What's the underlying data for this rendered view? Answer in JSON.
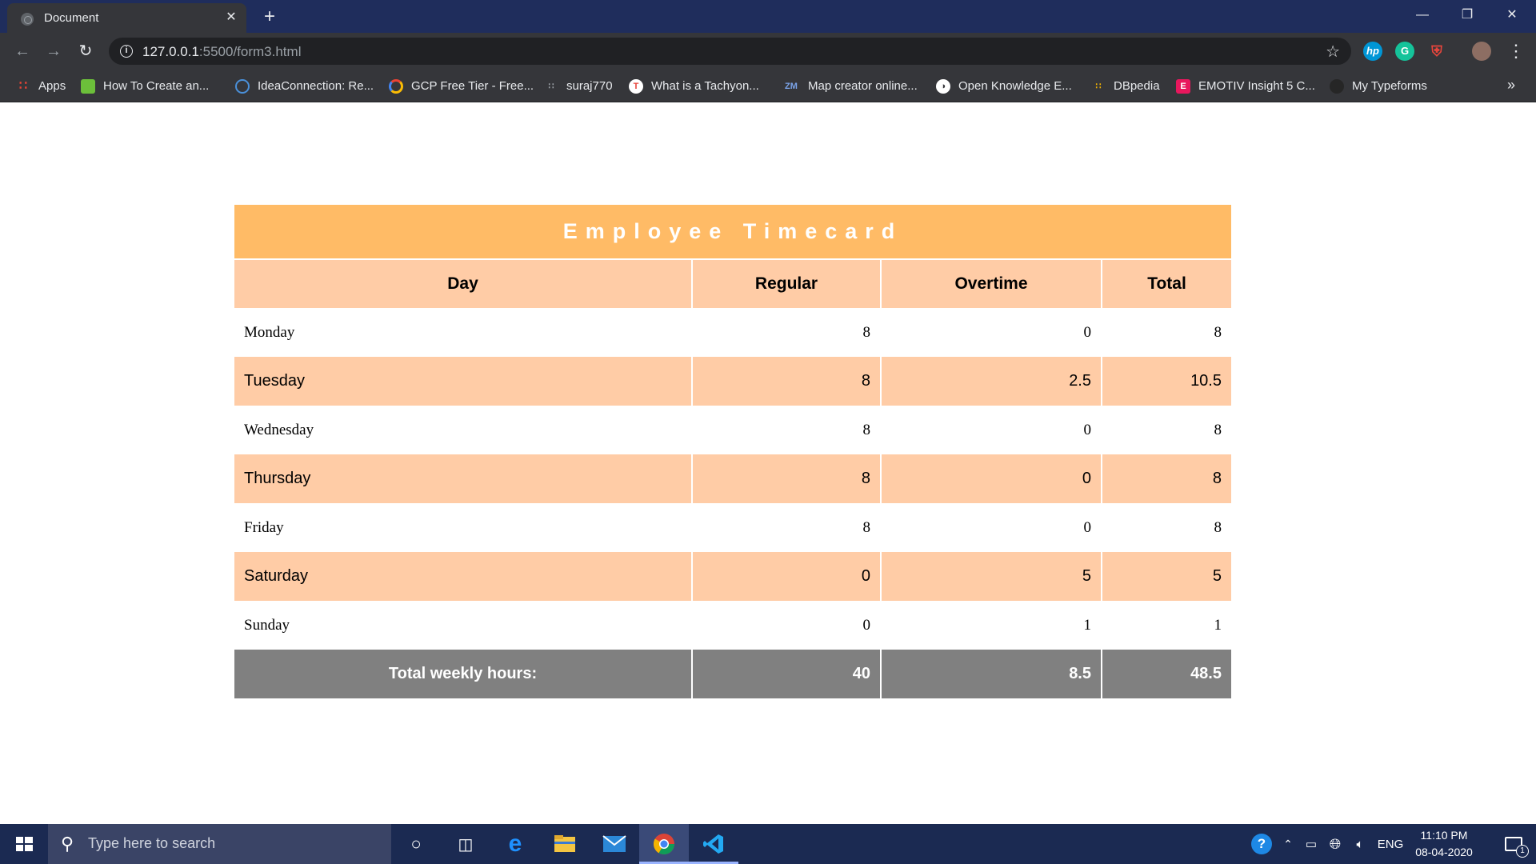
{
  "browser": {
    "tab_title": "Document",
    "url_host": "127.0.0.1",
    "url_path": ":5500/form3.html",
    "bookmarks": [
      {
        "label": "Apps",
        "icon": "apps-grid-icon"
      },
      {
        "label": "How To Create an...",
        "icon": "bookmark-favicon"
      },
      {
        "label": "IdeaConnection: Re...",
        "icon": "bookmark-favicon"
      },
      {
        "label": "GCP Free Tier - Free...",
        "icon": "google-cloud-icon"
      },
      {
        "label": "suraj770",
        "icon": "bookmark-favicon"
      },
      {
        "label": "What is a Tachyon...",
        "icon": "bookmark-favicon"
      },
      {
        "label": "Map creator online...",
        "icon": "bookmark-favicon"
      },
      {
        "label": "Open Knowledge E...",
        "icon": "globe-icon"
      },
      {
        "label": "DBpedia",
        "icon": "bookmark-favicon"
      },
      {
        "label": "EMOTIV Insight 5 C...",
        "icon": "bookmark-favicon"
      },
      {
        "label": "My Typeforms",
        "icon": "bookmark-favicon"
      }
    ]
  },
  "timecard": {
    "title": "Employee Timecard",
    "headers": [
      "Day",
      "Regular",
      "Overtime",
      "Total"
    ],
    "rows": [
      {
        "day": "Monday",
        "regular": "8",
        "overtime": "0",
        "total": "8"
      },
      {
        "day": "Tuesday",
        "regular": "8",
        "overtime": "2.5",
        "total": "10.5"
      },
      {
        "day": "Wednesday",
        "regular": "8",
        "overtime": "0",
        "total": "8"
      },
      {
        "day": "Thursday",
        "regular": "8",
        "overtime": "0",
        "total": "8"
      },
      {
        "day": "Friday",
        "regular": "8",
        "overtime": "0",
        "total": "8"
      },
      {
        "day": "Saturday",
        "regular": "0",
        "overtime": "5",
        "total": "5"
      },
      {
        "day": "Sunday",
        "regular": "0",
        "overtime": "1",
        "total": "1"
      }
    ],
    "footer": {
      "label": "Total weekly hours:",
      "regular": "40",
      "overtime": "8.5",
      "total": "48.5"
    }
  },
  "taskbar": {
    "search_placeholder": "Type here to search",
    "language": "ENG",
    "time": "11:10 PM",
    "date": "08-04-2020",
    "notification_count": "1"
  },
  "colors": {
    "caption_bg": "#ffbb66",
    "header_bg": "#ffcca6",
    "footer_bg": "#808080"
  }
}
